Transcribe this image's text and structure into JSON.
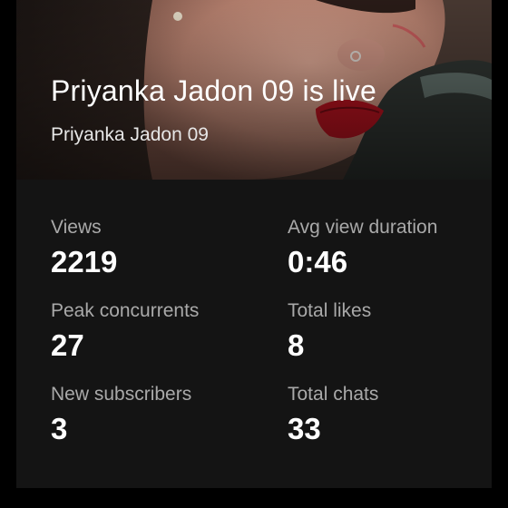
{
  "stream": {
    "title": "Priyanka Jadon 09 is live",
    "channel": "Priyanka Jadon 09"
  },
  "stats": [
    {
      "label": "Views",
      "value": "2219"
    },
    {
      "label": "Avg view duration",
      "value": "0:46"
    },
    {
      "label": "Peak concurrents",
      "value": "27"
    },
    {
      "label": "Total likes",
      "value": "8"
    },
    {
      "label": "New subscribers",
      "value": "3"
    },
    {
      "label": "Total chats",
      "value": "33"
    }
  ],
  "colors": {
    "background": "#000000",
    "card": "#141414",
    "label": "#a9a9a9",
    "value": "#ffffff"
  }
}
